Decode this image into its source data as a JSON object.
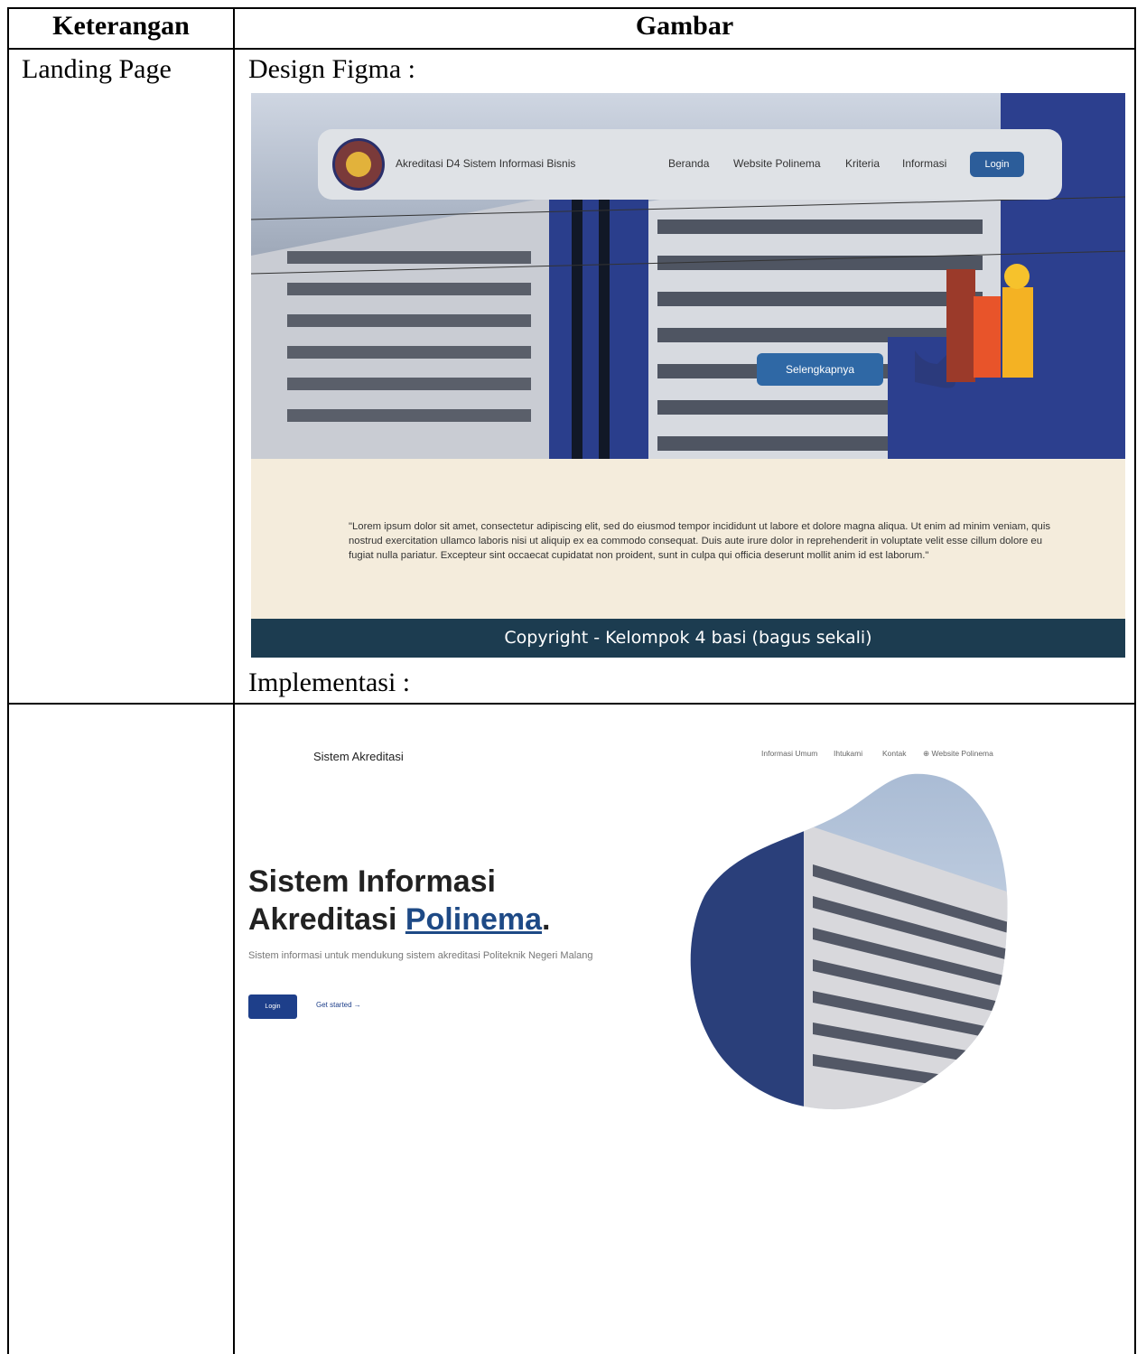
{
  "table": {
    "header_left": "Keterangan",
    "header_right": "Gambar",
    "row1_label": "Landing Page",
    "design_label": "Design Figma :",
    "implementation_label": "Implementasi :"
  },
  "figma": {
    "site_title": "Akreditasi D4 Sistem Informasi Bisnis",
    "nav": [
      "Beranda",
      "Website Polinema",
      "Kriteria",
      "Informasi"
    ],
    "login_label": "Login",
    "more_button": "Selengkapnya",
    "lorem": "\"Lorem ipsum dolor sit amet, consectetur adipiscing elit, sed do eiusmod tempor incididunt ut labore et dolore magna aliqua. Ut enim ad minim veniam, quis nostrud exercitation ullamco laboris nisi ut aliquip ex ea commodo consequat. Duis aute irure dolor in reprehenderit in voluptate velit esse cillum dolore eu fugiat nulla pariatur. Excepteur sint occaecat cupidatat non proident, sunt in culpa qui officia deserunt mollit anim id est laborum.\"",
    "footer": "Copyright - Kelompok 4 basi (bagus sekali)",
    "colors": {
      "nav_button": "#2c5d9a",
      "footer": "#1c3c50",
      "content_bg": "#f4ecdc"
    }
  },
  "implementation": {
    "brand": "Sistem Akreditasi",
    "nav": [
      "Informasi Umum",
      "Ihtukami",
      "Kontak",
      "Website Polinema"
    ],
    "headline_line1": "Sistem Informasi",
    "headline_line2_prefix": "Akreditasi ",
    "headline_highlight": "Polinema",
    "headline_suffix": ".",
    "subtitle": "Sistem informasi untuk mendukung sistem akreditasi Politeknik Negeri Malang",
    "login_button": "Login",
    "get_started": "Get started →",
    "colors": {
      "accent": "#1e4a86",
      "button": "#1e3f8a"
    }
  }
}
